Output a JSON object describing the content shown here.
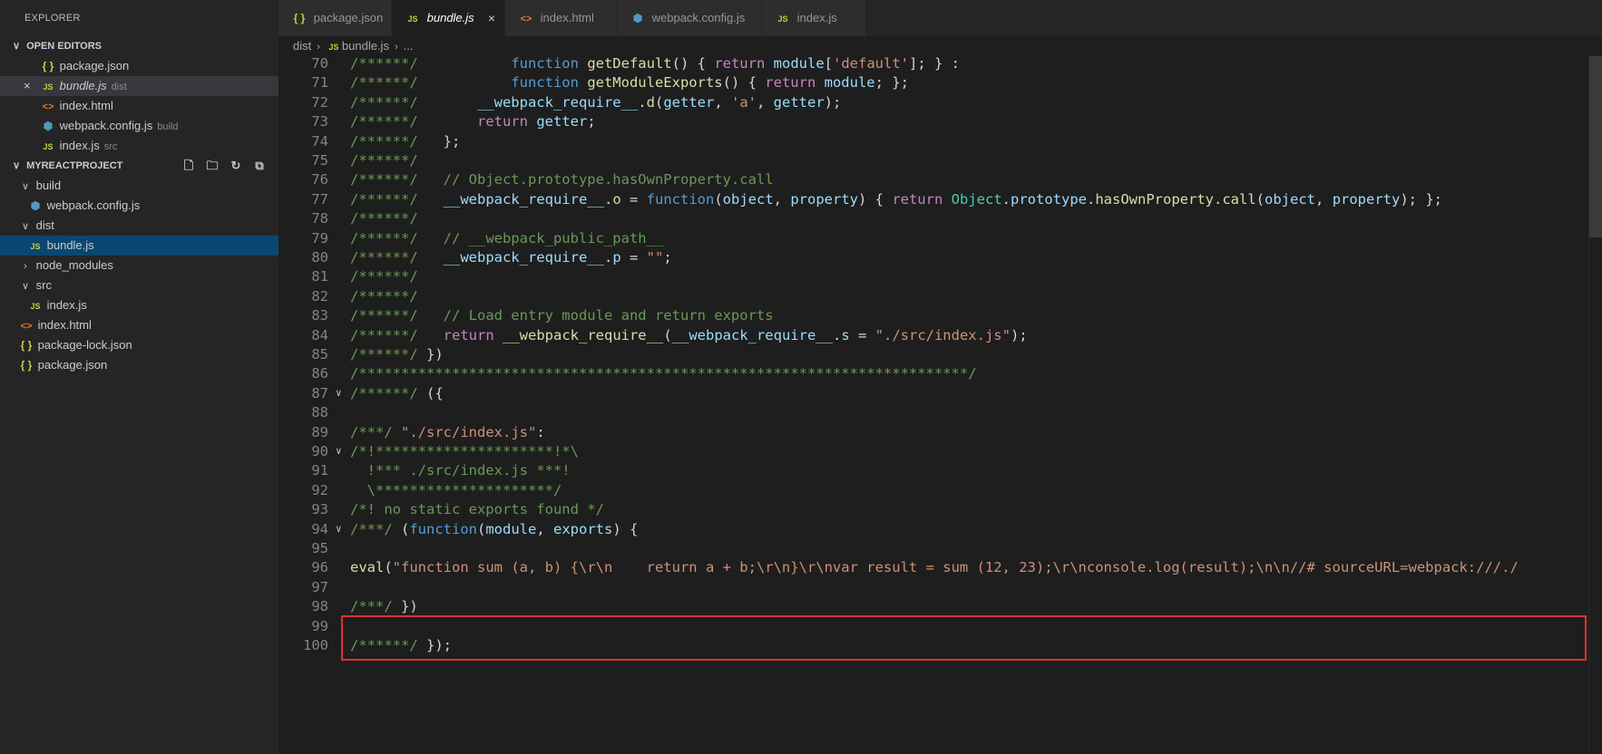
{
  "sidebar": {
    "title": "EXPLORER",
    "open_editors": {
      "header": "OPEN EDITORS",
      "items": [
        {
          "icon": "json",
          "label": "package.json",
          "hint": ""
        },
        {
          "icon": "js",
          "label": "bundle.js",
          "hint": "dist"
        },
        {
          "icon": "html",
          "label": "index.html",
          "hint": ""
        },
        {
          "icon": "webpack",
          "label": "webpack.config.js",
          "hint": "build"
        },
        {
          "icon": "js",
          "label": "index.js",
          "hint": "src"
        }
      ]
    },
    "project": {
      "header": "MYREACTPROJECT",
      "items": [
        {
          "label": "build"
        },
        {
          "label": "webpack.config.js"
        },
        {
          "label": "dist"
        },
        {
          "label": "bundle.js"
        },
        {
          "label": "node_modules"
        },
        {
          "label": "src"
        },
        {
          "label": "index.js"
        },
        {
          "label": "index.html"
        },
        {
          "label": "package-lock.json"
        },
        {
          "label": "package.json"
        }
      ]
    }
  },
  "icons": {
    "json": "{ }",
    "js": "JS",
    "html": "<>",
    "webpack": "⬢",
    "chevron_down": "∨",
    "chevron_right": "›",
    "close": "×"
  },
  "tabs": [
    {
      "icon": "json",
      "label": "package.json"
    },
    {
      "icon": "js",
      "label": "bundle.js"
    },
    {
      "icon": "html",
      "label": "index.html"
    },
    {
      "icon": "webpack",
      "label": "webpack.config.js"
    },
    {
      "icon": "js",
      "label": "index.js"
    }
  ],
  "breadcrumbs": {
    "folder": "dist",
    "icon": "js",
    "file": "bundle.js",
    "more": "..."
  },
  "editor": {
    "lines": [
      {
        "n": "70",
        "fold": false,
        "tokens": [
          [
            "c",
            "/******/"
          ],
          [
            "p",
            "           "
          ],
          [
            "k",
            "function"
          ],
          [
            "p",
            " "
          ],
          [
            "f",
            "getDefault"
          ],
          [
            "p",
            "() { "
          ],
          [
            "x",
            "return"
          ],
          [
            "p",
            " "
          ],
          [
            "v",
            "module"
          ],
          [
            "p",
            "["
          ],
          [
            "s",
            "'default'"
          ],
          [
            "p",
            "]; } :"
          ]
        ]
      },
      {
        "n": "71",
        "fold": false,
        "tokens": [
          [
            "c",
            "/******/"
          ],
          [
            "p",
            "           "
          ],
          [
            "k",
            "function"
          ],
          [
            "p",
            " "
          ],
          [
            "f",
            "getModuleExports"
          ],
          [
            "p",
            "() { "
          ],
          [
            "x",
            "return"
          ],
          [
            "p",
            " "
          ],
          [
            "v",
            "module"
          ],
          [
            "p",
            "; };"
          ]
        ]
      },
      {
        "n": "72",
        "fold": false,
        "tokens": [
          [
            "c",
            "/******/"
          ],
          [
            "p",
            "       "
          ],
          [
            "v",
            "__webpack_require__"
          ],
          [
            "p",
            "."
          ],
          [
            "f",
            "d"
          ],
          [
            "p",
            "("
          ],
          [
            "v",
            "getter"
          ],
          [
            "p",
            ", "
          ],
          [
            "s",
            "'a'"
          ],
          [
            "p",
            ", "
          ],
          [
            "v",
            "getter"
          ],
          [
            "p",
            ");"
          ]
        ]
      },
      {
        "n": "73",
        "fold": false,
        "tokens": [
          [
            "c",
            "/******/"
          ],
          [
            "p",
            "       "
          ],
          [
            "x",
            "return"
          ],
          [
            "p",
            " "
          ],
          [
            "v",
            "getter"
          ],
          [
            "p",
            ";"
          ]
        ]
      },
      {
        "n": "74",
        "fold": false,
        "tokens": [
          [
            "c",
            "/******/"
          ],
          [
            "p",
            "   };"
          ]
        ]
      },
      {
        "n": "75",
        "fold": false,
        "tokens": [
          [
            "c",
            "/******/"
          ]
        ]
      },
      {
        "n": "76",
        "fold": false,
        "tokens": [
          [
            "c",
            "/******/"
          ],
          [
            "p",
            "   "
          ],
          [
            "c",
            "// Object.prototype.hasOwnProperty.call"
          ]
        ]
      },
      {
        "n": "77",
        "fold": false,
        "tokens": [
          [
            "c",
            "/******/"
          ],
          [
            "p",
            "   "
          ],
          [
            "v",
            "__webpack_require__"
          ],
          [
            "p",
            "."
          ],
          [
            "f",
            "o"
          ],
          [
            "p",
            " = "
          ],
          [
            "k",
            "function"
          ],
          [
            "p",
            "("
          ],
          [
            "v",
            "object"
          ],
          [
            "p",
            ", "
          ],
          [
            "v",
            "property"
          ],
          [
            "p",
            ") { "
          ],
          [
            "x",
            "return"
          ],
          [
            "p",
            " "
          ],
          [
            "t",
            "Object"
          ],
          [
            "p",
            "."
          ],
          [
            "v",
            "prototype"
          ],
          [
            "p",
            "."
          ],
          [
            "f",
            "hasOwnProperty"
          ],
          [
            "p",
            "."
          ],
          [
            "f",
            "call"
          ],
          [
            "p",
            "("
          ],
          [
            "v",
            "object"
          ],
          [
            "p",
            ", "
          ],
          [
            "v",
            "property"
          ],
          [
            "p",
            "); };"
          ]
        ]
      },
      {
        "n": "78",
        "fold": false,
        "tokens": [
          [
            "c",
            "/******/"
          ]
        ]
      },
      {
        "n": "79",
        "fold": false,
        "tokens": [
          [
            "c",
            "/******/"
          ],
          [
            "p",
            "   "
          ],
          [
            "c",
            "// __webpack_public_path__"
          ]
        ]
      },
      {
        "n": "80",
        "fold": false,
        "tokens": [
          [
            "c",
            "/******/"
          ],
          [
            "p",
            "   "
          ],
          [
            "v",
            "__webpack_require__"
          ],
          [
            "p",
            "."
          ],
          [
            "v",
            "p"
          ],
          [
            "p",
            " = "
          ],
          [
            "s",
            "\"\""
          ],
          [
            "p",
            ";"
          ]
        ]
      },
      {
        "n": "81",
        "fold": false,
        "tokens": [
          [
            "c",
            "/******/"
          ]
        ]
      },
      {
        "n": "82",
        "fold": false,
        "tokens": [
          [
            "c",
            "/******/"
          ]
        ]
      },
      {
        "n": "83",
        "fold": false,
        "tokens": [
          [
            "c",
            "/******/"
          ],
          [
            "p",
            "   "
          ],
          [
            "c",
            "// Load entry module and return exports"
          ]
        ]
      },
      {
        "n": "84",
        "fold": false,
        "tokens": [
          [
            "c",
            "/******/"
          ],
          [
            "p",
            "   "
          ],
          [
            "x",
            "return"
          ],
          [
            "p",
            " "
          ],
          [
            "f",
            "__webpack_require__"
          ],
          [
            "p",
            "("
          ],
          [
            "v",
            "__webpack_require__"
          ],
          [
            "p",
            "."
          ],
          [
            "v",
            "s"
          ],
          [
            "p",
            " = "
          ],
          [
            "s",
            "\"./src/index.js\""
          ],
          [
            "p",
            ");"
          ]
        ]
      },
      {
        "n": "85",
        "fold": false,
        "tokens": [
          [
            "c",
            "/******/"
          ],
          [
            "p",
            " })"
          ]
        ]
      },
      {
        "n": "86",
        "fold": false,
        "tokens": [
          [
            "c",
            "/************************************************************************/"
          ]
        ]
      },
      {
        "n": "87",
        "fold": true,
        "tokens": [
          [
            "c",
            "/******/"
          ],
          [
            "p",
            " ({"
          ]
        ]
      },
      {
        "n": "88",
        "fold": false,
        "tokens": []
      },
      {
        "n": "89",
        "fold": false,
        "tokens": [
          [
            "c",
            "/***/"
          ],
          [
            "p",
            " "
          ],
          [
            "s",
            "\"./src/index.js\""
          ],
          [
            "p",
            ":"
          ]
        ]
      },
      {
        "n": "90",
        "fold": true,
        "tokens": [
          [
            "c",
            "/*!*********************!*\\"
          ]
        ]
      },
      {
        "n": "91",
        "fold": false,
        "tokens": [
          [
            "c",
            "  !*** ./src/index.js ***!"
          ]
        ]
      },
      {
        "n": "92",
        "fold": false,
        "tokens": [
          [
            "c",
            "  \\*********************/"
          ]
        ]
      },
      {
        "n": "93",
        "fold": false,
        "tokens": [
          [
            "c",
            "/*! no static exports found */"
          ]
        ]
      },
      {
        "n": "94",
        "fold": true,
        "tokens": [
          [
            "c",
            "/***/"
          ],
          [
            "p",
            " ("
          ],
          [
            "k",
            "function"
          ],
          [
            "p",
            "("
          ],
          [
            "v",
            "module"
          ],
          [
            "p",
            ", "
          ],
          [
            "v",
            "exports"
          ],
          [
            "p",
            ") {"
          ]
        ]
      },
      {
        "n": "95",
        "fold": false,
        "tokens": []
      },
      {
        "n": "96",
        "fold": false,
        "tokens": [
          [
            "f",
            "eval"
          ],
          [
            "p",
            "("
          ],
          [
            "s",
            "\"function sum (a, b) {\\r\\n    return a + b;\\r\\n}\\r\\nvar result = sum (12, 23);\\r\\nconsole.log(result);\\n\\n//# sourceURL=webpack:///./"
          ]
        ]
      },
      {
        "n": "97",
        "fold": false,
        "tokens": []
      },
      {
        "n": "98",
        "fold": false,
        "tokens": [
          [
            "c",
            "/***/"
          ],
          [
            "p",
            " })"
          ]
        ]
      },
      {
        "n": "99",
        "fold": false,
        "tokens": []
      },
      {
        "n": "100",
        "fold": false,
        "tokens": [
          [
            "c",
            "/******/"
          ],
          [
            "p",
            " });"
          ]
        ]
      }
    ]
  }
}
